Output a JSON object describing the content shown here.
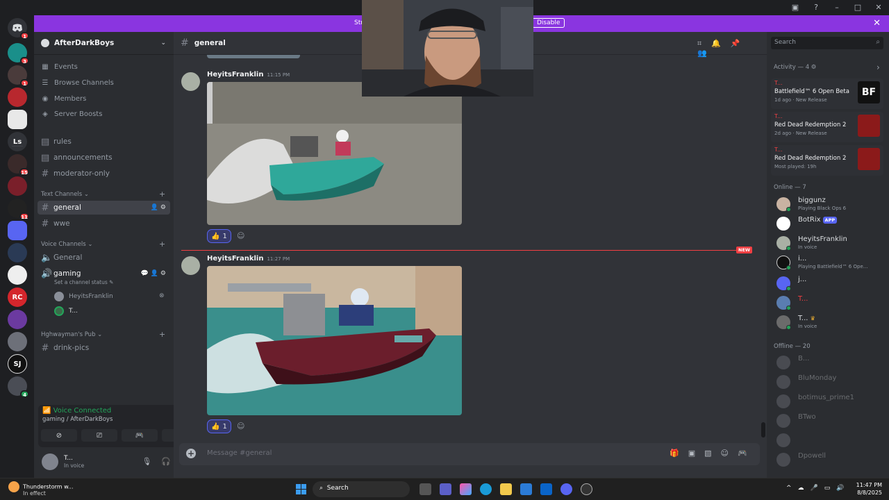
{
  "banner": {
    "text_left": "Str",
    "disable_label": "Disable"
  },
  "guild": {
    "name": "AfterDarkBoys"
  },
  "nav": [
    {
      "label": "Events",
      "icon": "calendar-icon"
    },
    {
      "label": "Browse Channels",
      "icon": "list-icon"
    },
    {
      "label": "Members",
      "icon": "members-icon"
    },
    {
      "label": "Server Boosts",
      "icon": "boost-icon"
    }
  ],
  "pinned_channels": [
    "rules",
    "announcements",
    "moderator-only"
  ],
  "categories": {
    "text": "Text Channels",
    "voice": "Voice Channels",
    "pub": "Hghwayman's Pub"
  },
  "text_channels": [
    "general",
    "wwe"
  ],
  "voice_channels": {
    "general": "General",
    "gaming": "gaming",
    "gaming_status": "Set a channel status",
    "members": [
      "HeyitsFranklin",
      "T..."
    ]
  },
  "pub_channels": [
    "drink-pics"
  ],
  "voice_panel": {
    "status": "Voice Connected",
    "location": "gaming / AfterDarkBoys"
  },
  "user": {
    "name": "T...",
    "status": "In voice"
  },
  "servers": [
    {
      "label": "",
      "badge": "1"
    },
    {
      "label": "",
      "badge": "3"
    },
    {
      "label": "",
      "badge": "1"
    },
    {
      "label": "",
      "badge": ""
    },
    {
      "label": "",
      "badge": ""
    },
    {
      "label": "Ls",
      "badge": ""
    },
    {
      "label": "",
      "badge": "15"
    },
    {
      "label": "",
      "badge": ""
    },
    {
      "label": "",
      "badge": "11"
    },
    {
      "label": "",
      "badge": ""
    },
    {
      "label": "",
      "badge": ""
    },
    {
      "label": "",
      "badge": ""
    },
    {
      "label": "RC",
      "badge": ""
    },
    {
      "label": "",
      "badge": ""
    },
    {
      "label": "",
      "badge": ""
    },
    {
      "label": "SJ",
      "badge": ""
    },
    {
      "label": "",
      "badge": "4"
    }
  ],
  "chat": {
    "channel": "general",
    "messages": [
      {
        "author": "HeyitsFranklin",
        "time": "11:15 PM",
        "reaction_count": "1"
      },
      {
        "author": "HeyitsFranklin",
        "time": "11:27 PM",
        "reaction_count": "1"
      }
    ],
    "new_label": "NEW",
    "composer_placeholder": "Message #general"
  },
  "search": {
    "placeholder": "Search"
  },
  "activity": {
    "header": "Activity — 4",
    "cards": [
      {
        "who": "T...",
        "game": "Battlefield™ 6 Open Beta",
        "meta": "1d ago · New Release",
        "art_text": "BF"
      },
      {
        "who": "T...",
        "game": "Red Dead Redemption 2",
        "meta": "2d ago · New Release",
        "art_text": ""
      },
      {
        "who": "T...",
        "game": "Red Dead Redemption 2",
        "meta": "Most played: 19h",
        "art_text": ""
      }
    ]
  },
  "online": {
    "header": "Online — 7",
    "members": [
      {
        "name": "biggunz",
        "status": "Playing Black Ops 6"
      },
      {
        "name": "BotRix",
        "status": "",
        "badge": "APP"
      },
      {
        "name": "HeyitsFranklin",
        "status": "In voice"
      },
      {
        "name": "i...",
        "status": "Playing Battlefield™ 6 Ope..."
      },
      {
        "name": "j...",
        "status": ""
      },
      {
        "name": "T...",
        "status": ""
      },
      {
        "name": "T...",
        "status": "In voice"
      }
    ]
  },
  "offline": {
    "header": "Offline — 20",
    "members": [
      "B...",
      "BluMonday",
      "botimus_prime1",
      "BTwo",
      "",
      "Dpowell"
    ]
  },
  "taskbar": {
    "weather_title": "Thunderstorm w...",
    "weather_sub": "In effect",
    "search_label": "Search",
    "time": "11:47 PM",
    "date": "8/8/2025"
  }
}
